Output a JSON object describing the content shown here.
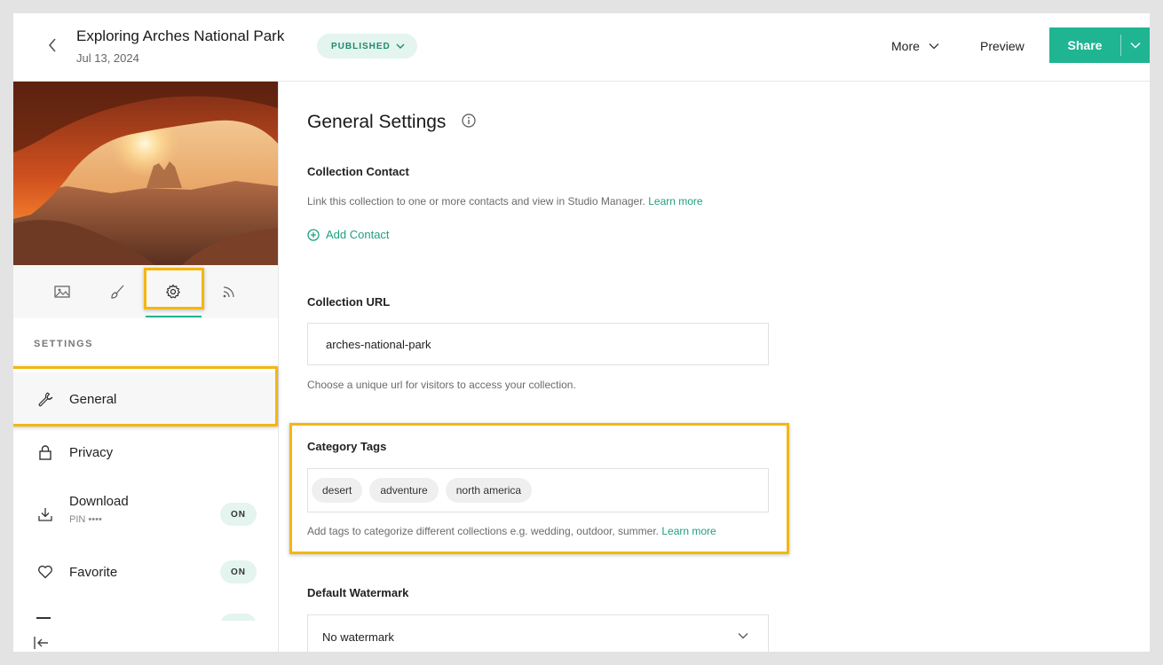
{
  "header": {
    "title": "Exploring Arches National Park",
    "date": "Jul 13, 2024",
    "status": "PUBLISHED",
    "more_label": "More",
    "preview_label": "Preview",
    "share_label": "Share",
    "accent_color": "#1fb592"
  },
  "sidebar": {
    "tabs": [
      {
        "icon": "image-icon"
      },
      {
        "icon": "brush-icon"
      },
      {
        "icon": "gear-icon",
        "active": true
      },
      {
        "icon": "rss-icon"
      }
    ],
    "section_label": "SETTINGS",
    "items": [
      {
        "label": "General",
        "icon": "wrench-icon",
        "active": true
      },
      {
        "label": "Privacy",
        "icon": "lock-icon"
      },
      {
        "label": "Download",
        "icon": "download-icon",
        "sub": "PIN ••••",
        "toggle": "ON"
      },
      {
        "label": "Favorite",
        "icon": "heart-icon",
        "toggle": "ON"
      }
    ]
  },
  "main": {
    "title": "General Settings",
    "contact": {
      "label": "Collection Contact",
      "help": "Link this collection to one or more contacts and view in Studio Manager.",
      "learn_more": "Learn more",
      "add_label": "Add Contact"
    },
    "url": {
      "label": "Collection URL",
      "value": "arches-national-park",
      "help": "Choose a unique url for visitors to access your collection."
    },
    "tags": {
      "label": "Category Tags",
      "items": [
        "desert",
        "adventure",
        "north america"
      ],
      "help": "Add tags to categorize different collections e.g. wedding, outdoor, summer.",
      "learn_more": "Learn more"
    },
    "watermark": {
      "label": "Default Watermark",
      "value": "No watermark"
    }
  }
}
